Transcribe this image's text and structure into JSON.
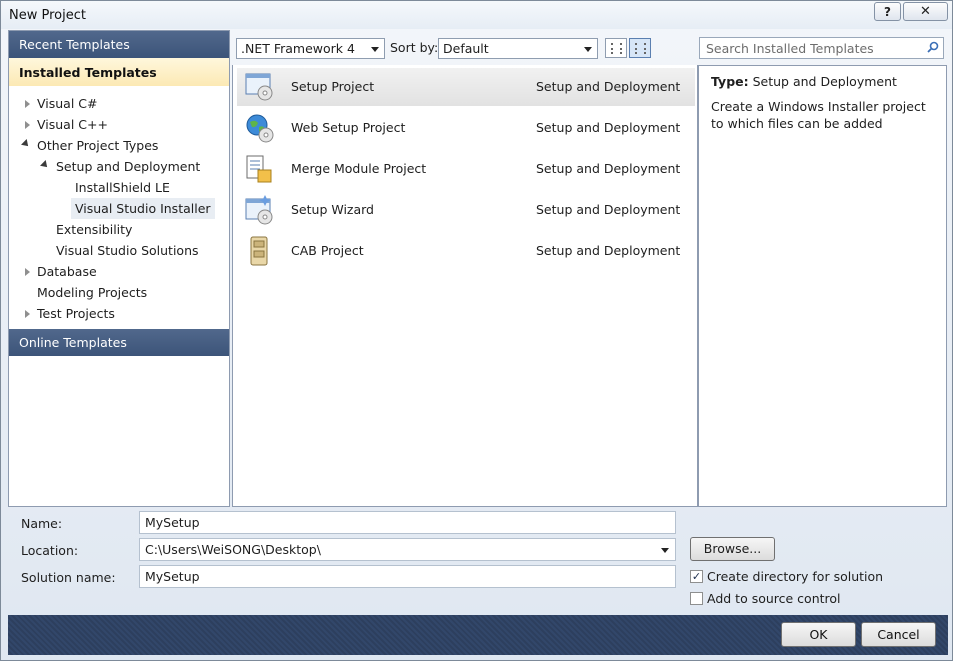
{
  "window": {
    "title": "New Project",
    "help_label": "?",
    "close_label": "✕"
  },
  "sidebar": {
    "recent_label": "Recent Templates",
    "installed_label": "Installed Templates",
    "online_label": "Online Templates",
    "tree": [
      {
        "label": "Visual C#",
        "state": "collapsed"
      },
      {
        "label": "Visual C++",
        "state": "collapsed"
      },
      {
        "label": "Other Project Types",
        "state": "expanded"
      },
      {
        "label": "Setup and Deployment",
        "state": "expanded"
      },
      {
        "label": "InstallShield LE",
        "state": "leaf"
      },
      {
        "label": "Visual Studio Installer",
        "state": "leaf",
        "selected": true
      },
      {
        "label": "Extensibility",
        "state": "leaf"
      },
      {
        "label": "Visual Studio Solutions",
        "state": "leaf"
      },
      {
        "label": "Database",
        "state": "collapsed"
      },
      {
        "label": "Modeling Projects",
        "state": "leaf"
      },
      {
        "label": "Test Projects",
        "state": "collapsed"
      }
    ]
  },
  "toolbar": {
    "framework": ".NET Framework 4",
    "sort_label": "Sort by:",
    "sort_value": "Default"
  },
  "templates": [
    {
      "name": "Setup Project",
      "type": "Setup and Deployment",
      "icon": "setup-project-icon",
      "selected": true
    },
    {
      "name": "Web Setup Project",
      "type": "Setup and Deployment",
      "icon": "web-setup-icon"
    },
    {
      "name": "Merge Module Project",
      "type": "Setup and Deployment",
      "icon": "merge-module-icon"
    },
    {
      "name": "Setup Wizard",
      "type": "Setup and Deployment",
      "icon": "setup-wizard-icon"
    },
    {
      "name": "CAB Project",
      "type": "Setup and Deployment",
      "icon": "cab-project-icon"
    }
  ],
  "search": {
    "placeholder": "Search Installed Templates"
  },
  "details": {
    "type_label": "Type:",
    "type_value": "Setup and Deployment",
    "description": "Create a Windows Installer project to which files can be added"
  },
  "form": {
    "name_label": "Name:",
    "name_value": "MySetup",
    "location_label": "Location:",
    "location_value": "C:\\Users\\WeiSONG\\Desktop\\",
    "solution_label": "Solution name:",
    "solution_value": "MySetup",
    "browse_label": "Browse...",
    "create_dir_label": "Create directory for solution",
    "create_dir_checked": true,
    "source_control_label": "Add to source control",
    "source_control_checked": false,
    "check_mark": "✓"
  },
  "buttons": {
    "ok": "OK",
    "cancel": "Cancel"
  },
  "colors": {
    "header_bar": "#3c5479",
    "installed_highlight": "#fce9b4",
    "footer": "#2d3f5e"
  }
}
